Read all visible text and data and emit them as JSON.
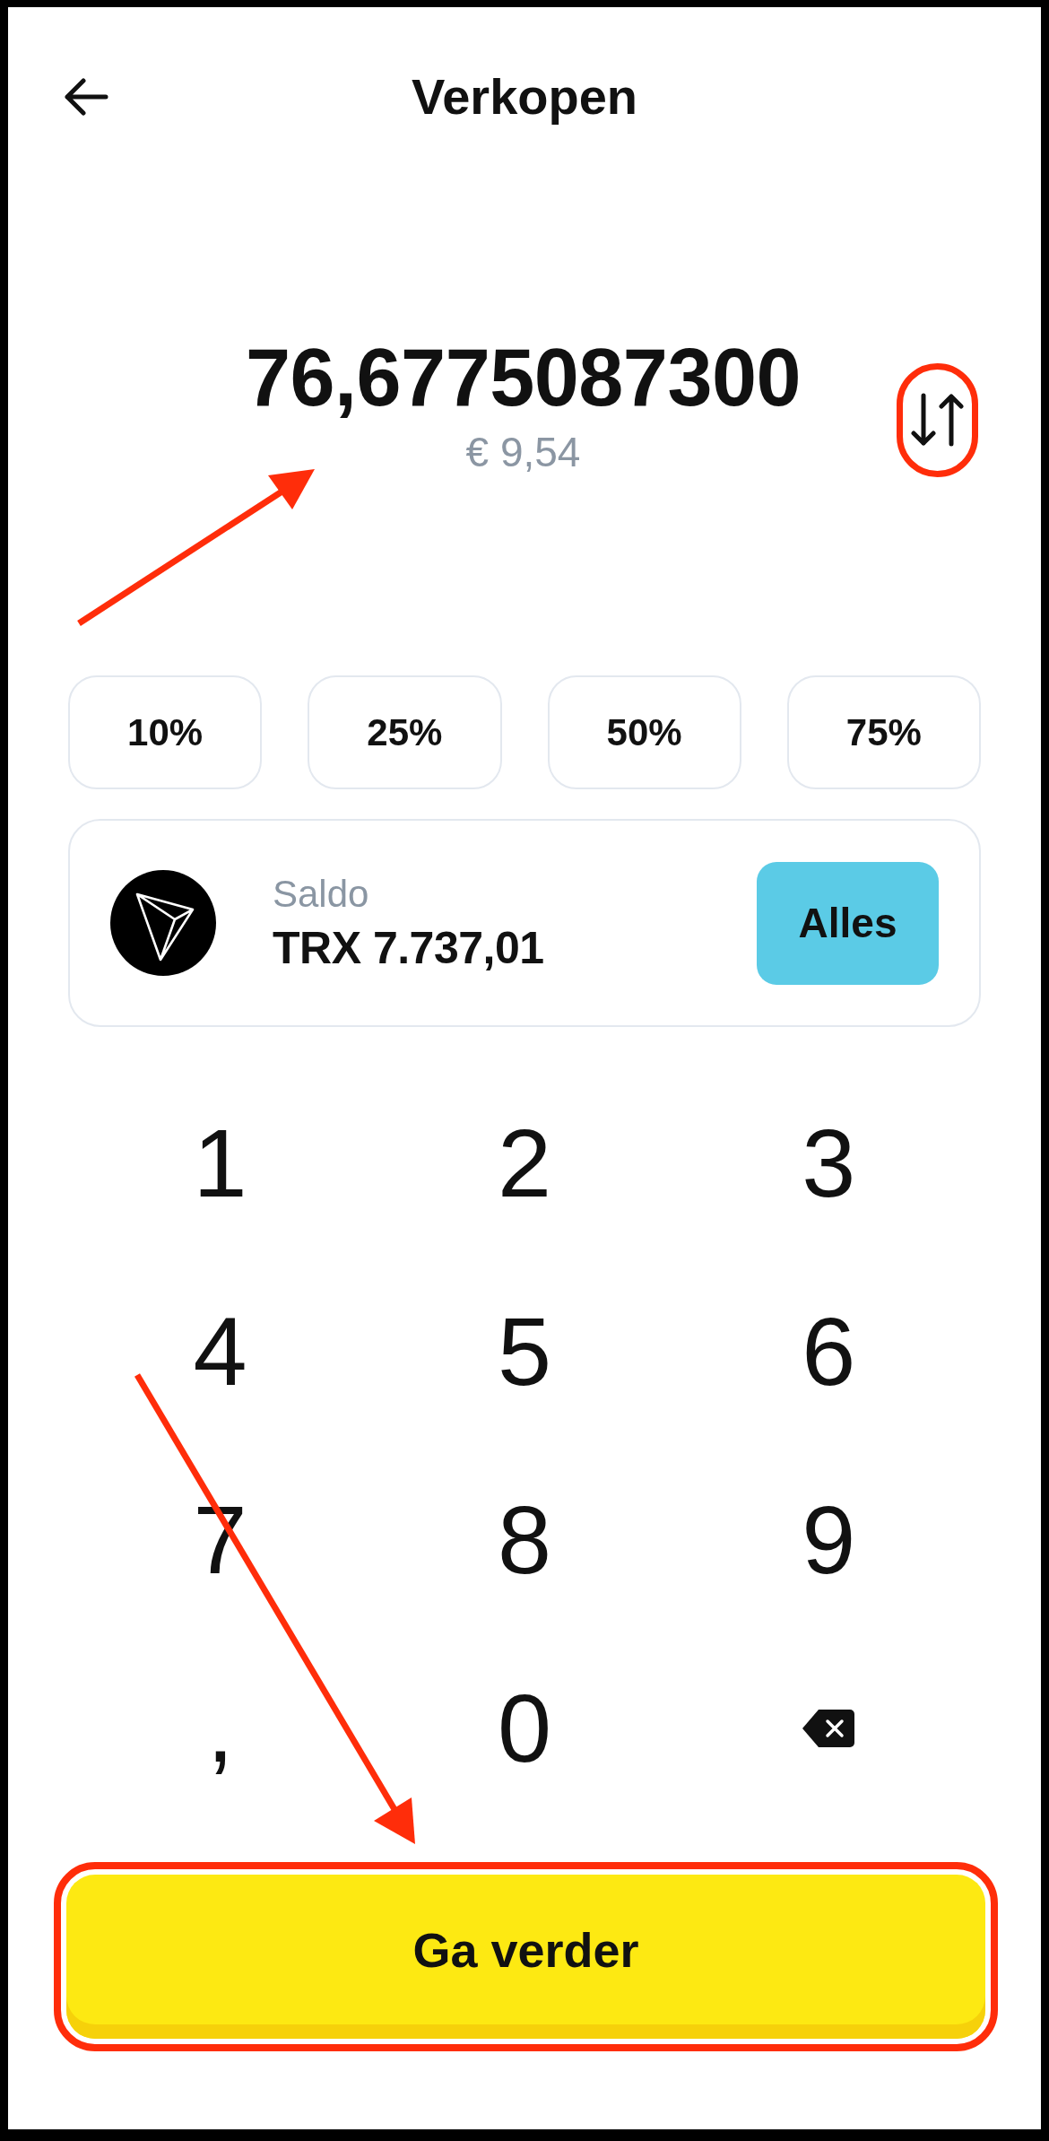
{
  "header": {
    "title": "Verkopen"
  },
  "amount": {
    "value": "76,6775087300",
    "fiat_value": "€ 9,54",
    "swap_button": {
      "highlighted": true
    }
  },
  "percent_buttons": [
    {
      "label": "10%"
    },
    {
      "label": "25%"
    },
    {
      "label": "50%"
    },
    {
      "label": "75%"
    }
  ],
  "balance": {
    "label": "Saldo",
    "value": "TRX 7.737,01",
    "max_button": "Alles"
  },
  "keypad": [
    {
      "kind": "char",
      "label": "1"
    },
    {
      "kind": "char",
      "label": "2"
    },
    {
      "kind": "char",
      "label": "3"
    },
    {
      "kind": "char",
      "label": "4"
    },
    {
      "kind": "char",
      "label": "5"
    },
    {
      "kind": "char",
      "label": "6"
    },
    {
      "kind": "char",
      "label": "7"
    },
    {
      "kind": "char",
      "label": "8"
    },
    {
      "kind": "char",
      "label": "9"
    },
    {
      "kind": "char",
      "label": ","
    },
    {
      "kind": "char",
      "label": "0"
    },
    {
      "kind": "backspace"
    }
  ],
  "continue_button": {
    "label": "Ga verder",
    "highlighted": true
  }
}
